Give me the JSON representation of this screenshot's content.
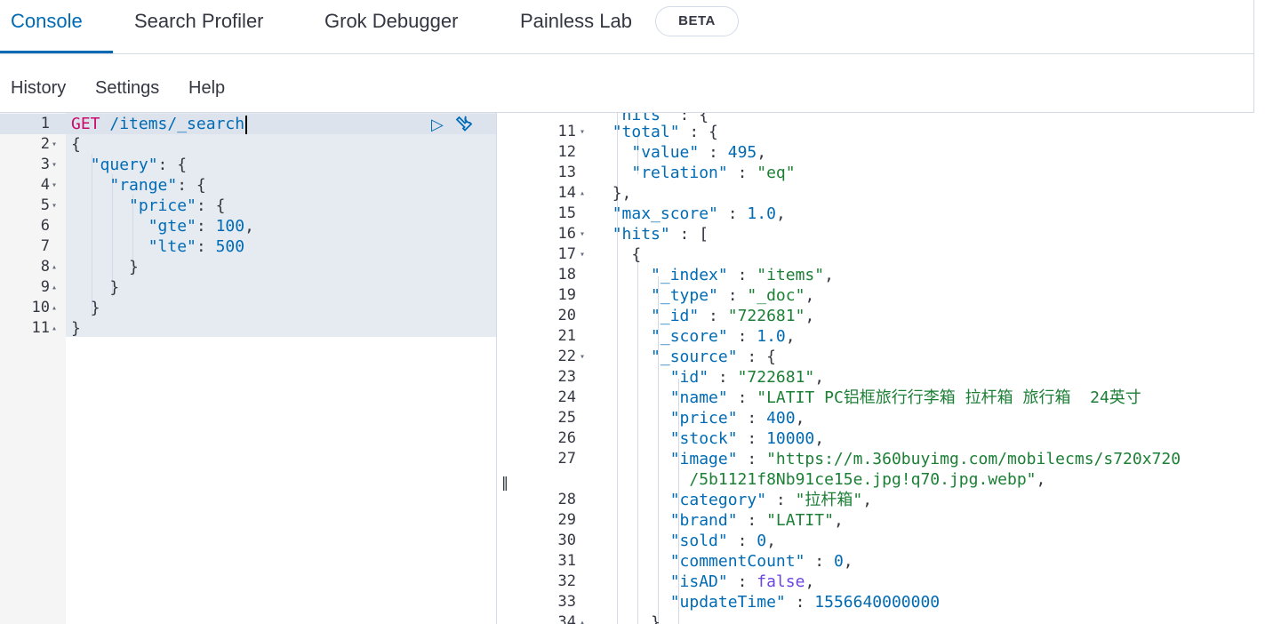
{
  "tabs": [
    {
      "label": "Console"
    },
    {
      "label": "Search Profiler"
    },
    {
      "label": "Grok Debugger"
    },
    {
      "label": "Painless Lab"
    }
  ],
  "beta_badge": "BETA",
  "toolbar": {
    "history": "History",
    "settings": "Settings",
    "help": "Help"
  },
  "request": {
    "method": "GET",
    "path": "/items/_search",
    "lines": [
      {
        "num": "1"
      },
      {
        "num": "2",
        "text": "{"
      },
      {
        "num": "3",
        "key": "\"query\"",
        "rest": ": {"
      },
      {
        "num": "4",
        "key": "\"range\"",
        "rest": ": {"
      },
      {
        "num": "5",
        "key": "\"price\"",
        "rest": ": {"
      },
      {
        "num": "6",
        "key": "\"gte\"",
        "value": "100",
        "rest": ","
      },
      {
        "num": "7",
        "key": "\"lte\"",
        "value": "500"
      },
      {
        "num": "8",
        "text": "}"
      },
      {
        "num": "9",
        "text": "}"
      },
      {
        "num": "10",
        "text": "}"
      },
      {
        "num": "11",
        "text": "}"
      }
    ]
  },
  "response": {
    "lines": [
      {
        "num": "11",
        "key": "\"total\"",
        "rest": " : {"
      },
      {
        "num": "12",
        "key": "\"value\"",
        "sep": " : ",
        "value": "495",
        "rest": ","
      },
      {
        "num": "13",
        "key": "\"relation\"",
        "sep": " : ",
        "str": "\"eq\""
      },
      {
        "num": "14",
        "text": "},"
      },
      {
        "num": "15",
        "key": "\"max_score\"",
        "sep": " : ",
        "value": "1.0",
        "rest": ","
      },
      {
        "num": "16",
        "key": "\"hits\"",
        "rest": " : ["
      },
      {
        "num": "17",
        "text": "{"
      },
      {
        "num": "18",
        "key": "\"_index\"",
        "sep": " : ",
        "str": "\"items\"",
        "rest": ","
      },
      {
        "num": "19",
        "key": "\"_type\"",
        "sep": " : ",
        "str": "\"_doc\"",
        "rest": ","
      },
      {
        "num": "20",
        "key": "\"_id\"",
        "sep": " : ",
        "str": "\"722681\"",
        "rest": ","
      },
      {
        "num": "21",
        "key": "\"_score\"",
        "sep": " : ",
        "value": "1.0",
        "rest": ","
      },
      {
        "num": "22",
        "key": "\"_source\"",
        "rest": " : {"
      },
      {
        "num": "23",
        "key": "\"id\"",
        "sep": " : ",
        "str": "\"722681\"",
        "rest": ","
      },
      {
        "num": "24",
        "key": "\"name\"",
        "sep": " : ",
        "str": "\"LATIT PC铝框旅行行李箱 拉杆箱 旅行箱  24英寸"
      },
      {
        "num": "25",
        "key": "\"price\"",
        "sep": " : ",
        "value": "400",
        "rest": ","
      },
      {
        "num": "26",
        "key": "\"stock\"",
        "sep": " : ",
        "value": "10000",
        "rest": ","
      },
      {
        "num": "27",
        "key": "\"image\"",
        "sep": " : ",
        "str": "\"https://m.360buyimg.com/mobilecms/s720x720"
      },
      {
        "num": "",
        "str": "/5b1121f8Nb91ce15e.jpg!q70.jpg.webp\"",
        "rest": ","
      },
      {
        "num": "28",
        "key": "\"category\"",
        "sep": " : ",
        "str": "\"拉杆箱\"",
        "rest": ","
      },
      {
        "num": "29",
        "key": "\"brand\"",
        "sep": " : ",
        "str": "\"LATIT\"",
        "rest": ","
      },
      {
        "num": "30",
        "key": "\"sold\"",
        "sep": " : ",
        "value": "0",
        "rest": ","
      },
      {
        "num": "31",
        "key": "\"commentCount\"",
        "sep": " : ",
        "value": "0",
        "rest": ","
      },
      {
        "num": "32",
        "key": "\"isAD\"",
        "sep": " : ",
        "bool": "false",
        "rest": ","
      },
      {
        "num": "33",
        "key": "\"updateTime\"",
        "sep": " : ",
        "value": "1556640000000"
      },
      {
        "num": "34",
        "text": "}"
      }
    ]
  },
  "colors": {
    "accent": "#006bb4",
    "method": "#c80a68",
    "string": "#1b7f35",
    "bool": "#6c44e0"
  },
  "icons": {
    "run": "play-icon",
    "settings": "wrench-icon",
    "resize": "grip-icon"
  }
}
